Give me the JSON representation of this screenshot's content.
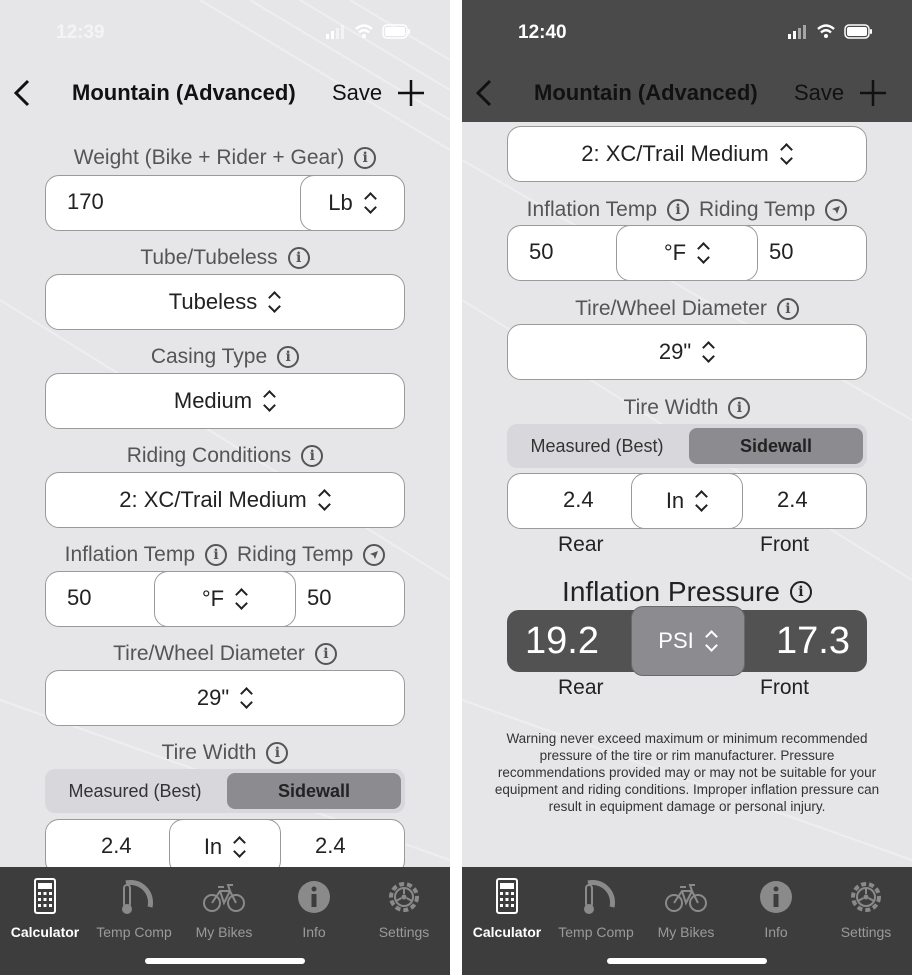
{
  "left": {
    "status": {
      "time": "12:39"
    },
    "nav": {
      "title": "Mountain (Advanced)",
      "save": "Save"
    },
    "weight": {
      "label": "Weight (Bike + Rider + Gear)",
      "value": "170",
      "unit": "Lb"
    },
    "tube": {
      "label": "Tube/Tubeless",
      "value": "Tubeless"
    },
    "casing": {
      "label": "Casing Type",
      "value": "Medium"
    },
    "conditions": {
      "label": "Riding Conditions",
      "value": "2: XC/Trail Medium"
    },
    "temps": {
      "inflation_label": "Inflation Temp",
      "riding_label": "Riding Temp",
      "inflation": "50",
      "unit": "°F",
      "riding": "50"
    },
    "diameter": {
      "label": "Tire/Wheel Diameter",
      "value": "29\""
    },
    "width": {
      "label": "Tire Width",
      "seg_measured": "Measured (Best)",
      "seg_sidewall": "Sidewall",
      "rear": "2.4",
      "unit": "In",
      "front": "2.4"
    }
  },
  "right": {
    "status": {
      "time": "12:40"
    },
    "nav": {
      "title": "Mountain (Advanced)",
      "save": "Save"
    },
    "conditions": {
      "value": "2: XC/Trail Medium"
    },
    "temps": {
      "inflation_label": "Inflation Temp",
      "riding_label": "Riding Temp",
      "inflation": "50",
      "unit": "°F",
      "riding": "50"
    },
    "diameter": {
      "label": "Tire/Wheel Diameter",
      "value": "29\""
    },
    "width": {
      "label": "Tire Width",
      "seg_measured": "Measured (Best)",
      "seg_sidewall": "Sidewall",
      "rear": "2.4",
      "unit": "In",
      "front": "2.4",
      "rear_label": "Rear",
      "front_label": "Front"
    },
    "pressure": {
      "label": "Inflation Pressure",
      "rear": "19.2",
      "unit": "PSI",
      "front": "17.3",
      "rear_label": "Rear",
      "front_label": "Front"
    },
    "warning": "Warning never exceed maximum or minimum recommended pressure of the tire or rim manufacturer. Pressure recommendations provided may or may not be suitable for your equipment and riding conditions. Improper inflation pressure can result in equipment damage or personal injury."
  },
  "tabs": [
    {
      "label": "Calculator",
      "icon": "calculator-icon"
    },
    {
      "label": "Temp Comp",
      "icon": "thermometer-icon"
    },
    {
      "label": "My Bikes",
      "icon": "bike-icon"
    },
    {
      "label": "Info",
      "icon": "info-icon"
    },
    {
      "label": "Settings",
      "icon": "settings-icon"
    }
  ],
  "colors": {
    "background": "#e6e6e9",
    "tabbar": "#3d3d3d",
    "pressure_box": "#525252",
    "segment_selected": "#8c8c90"
  }
}
